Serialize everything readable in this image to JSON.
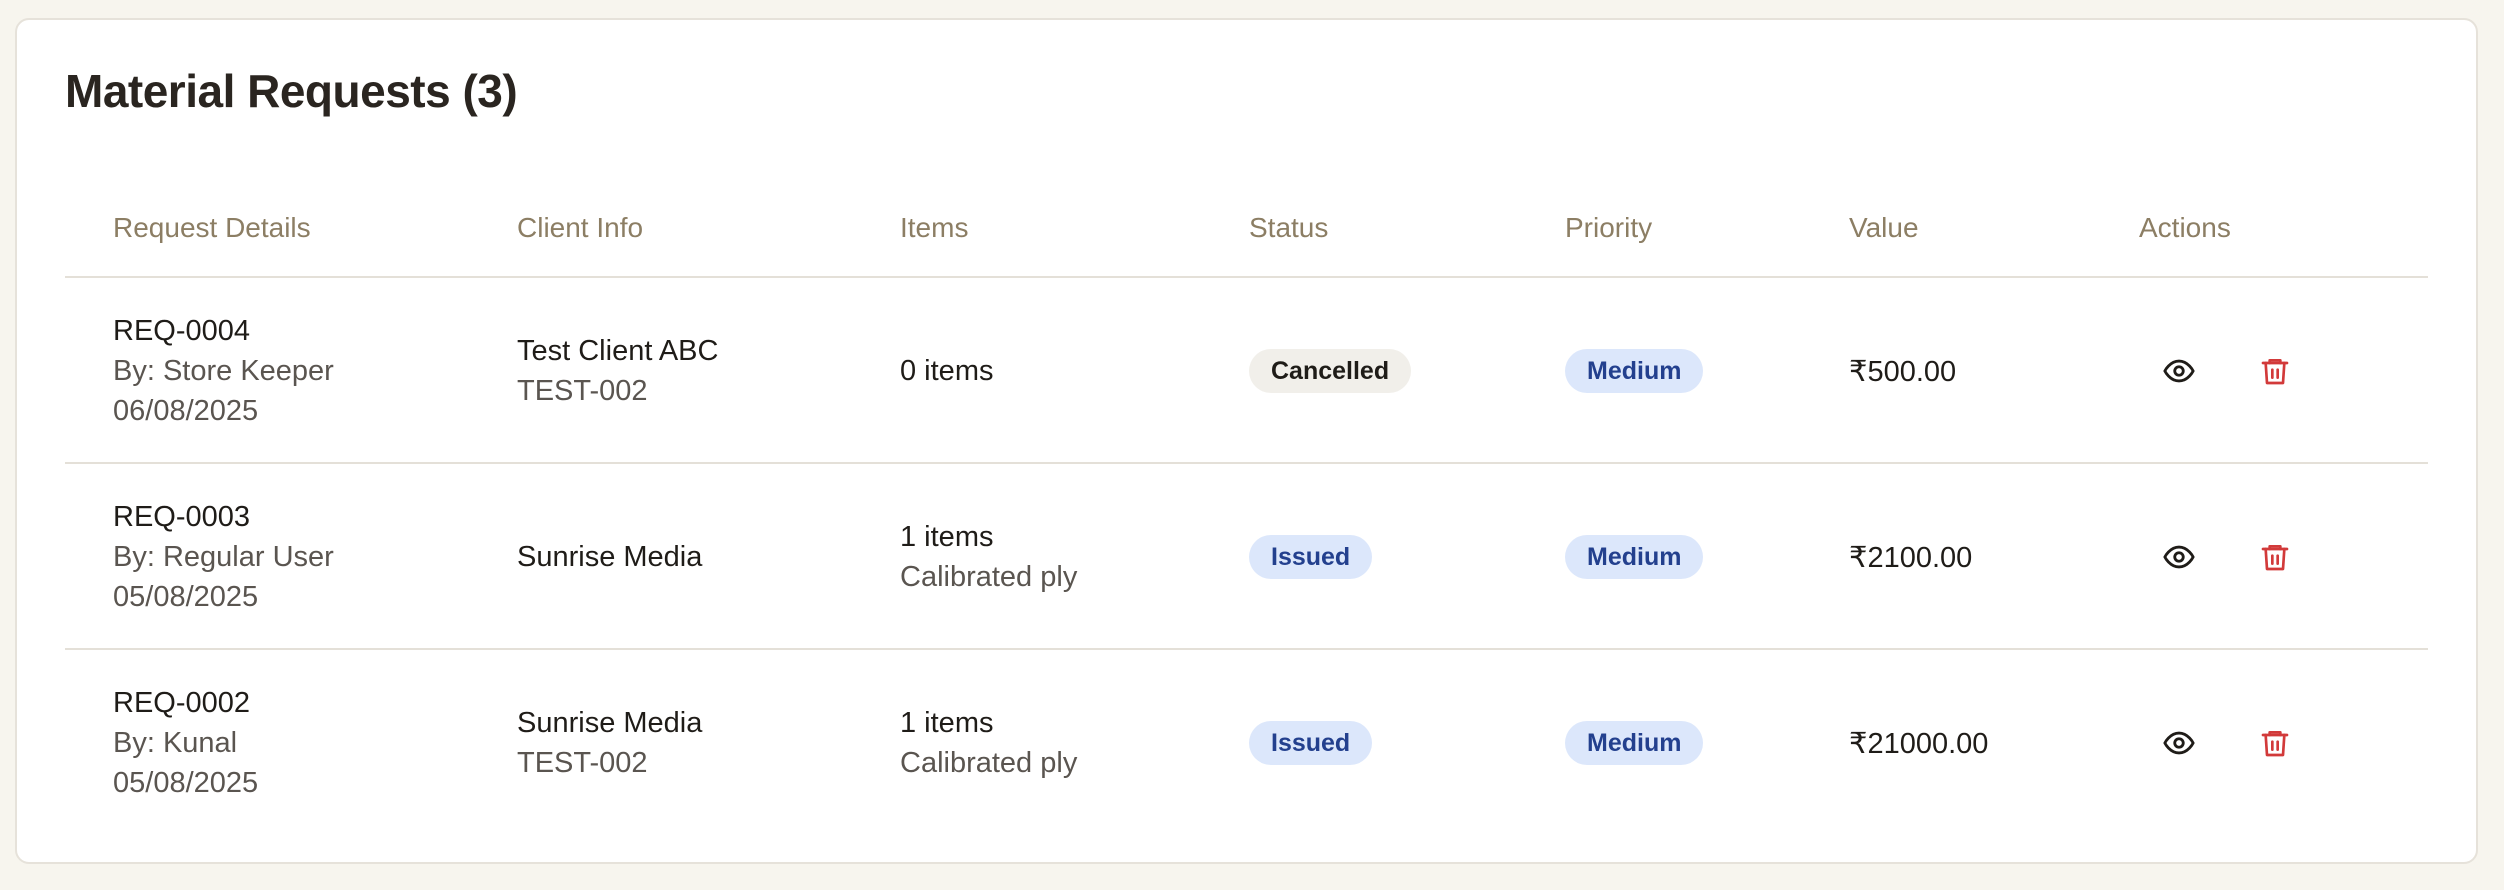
{
  "page": {
    "title": "Material Requests (3)"
  },
  "columns": {
    "request_details": "Request Details",
    "client_info": "Client Info",
    "items": "Items",
    "status": "Status",
    "priority": "Priority",
    "value": "Value",
    "actions": "Actions"
  },
  "colors": {
    "view_icon": "#1f1c18",
    "delete_icon": "#d23a3a",
    "issued_badge_bg": "#dce7fb",
    "cancelled_badge_bg": "#f1efea"
  },
  "icons": {
    "view": "eye-icon",
    "delete": "trash-icon"
  },
  "rows": [
    {
      "id": "REQ-0004",
      "by": "By: Store Keeper",
      "date": "06/08/2025",
      "client_name": "Test Client ABC",
      "client_code": "TEST-002",
      "items_count": "0 items",
      "items_desc": "",
      "status": "Cancelled",
      "priority": "Medium",
      "value": "₹500.00"
    },
    {
      "id": "REQ-0003",
      "by": "By: Regular User",
      "date": "05/08/2025",
      "client_name": "Sunrise Media",
      "client_code": "",
      "items_count": "1 items",
      "items_desc": "Calibrated ply",
      "status": "Issued",
      "priority": "Medium",
      "value": "₹2100.00"
    },
    {
      "id": "REQ-0002",
      "by": "By: Kunal",
      "date": "05/08/2025",
      "client_name": "Sunrise Media",
      "client_code": "TEST-002",
      "items_count": "1 items",
      "items_desc": "Calibrated ply",
      "status": "Issued",
      "priority": "Medium",
      "value": "₹21000.00"
    }
  ]
}
